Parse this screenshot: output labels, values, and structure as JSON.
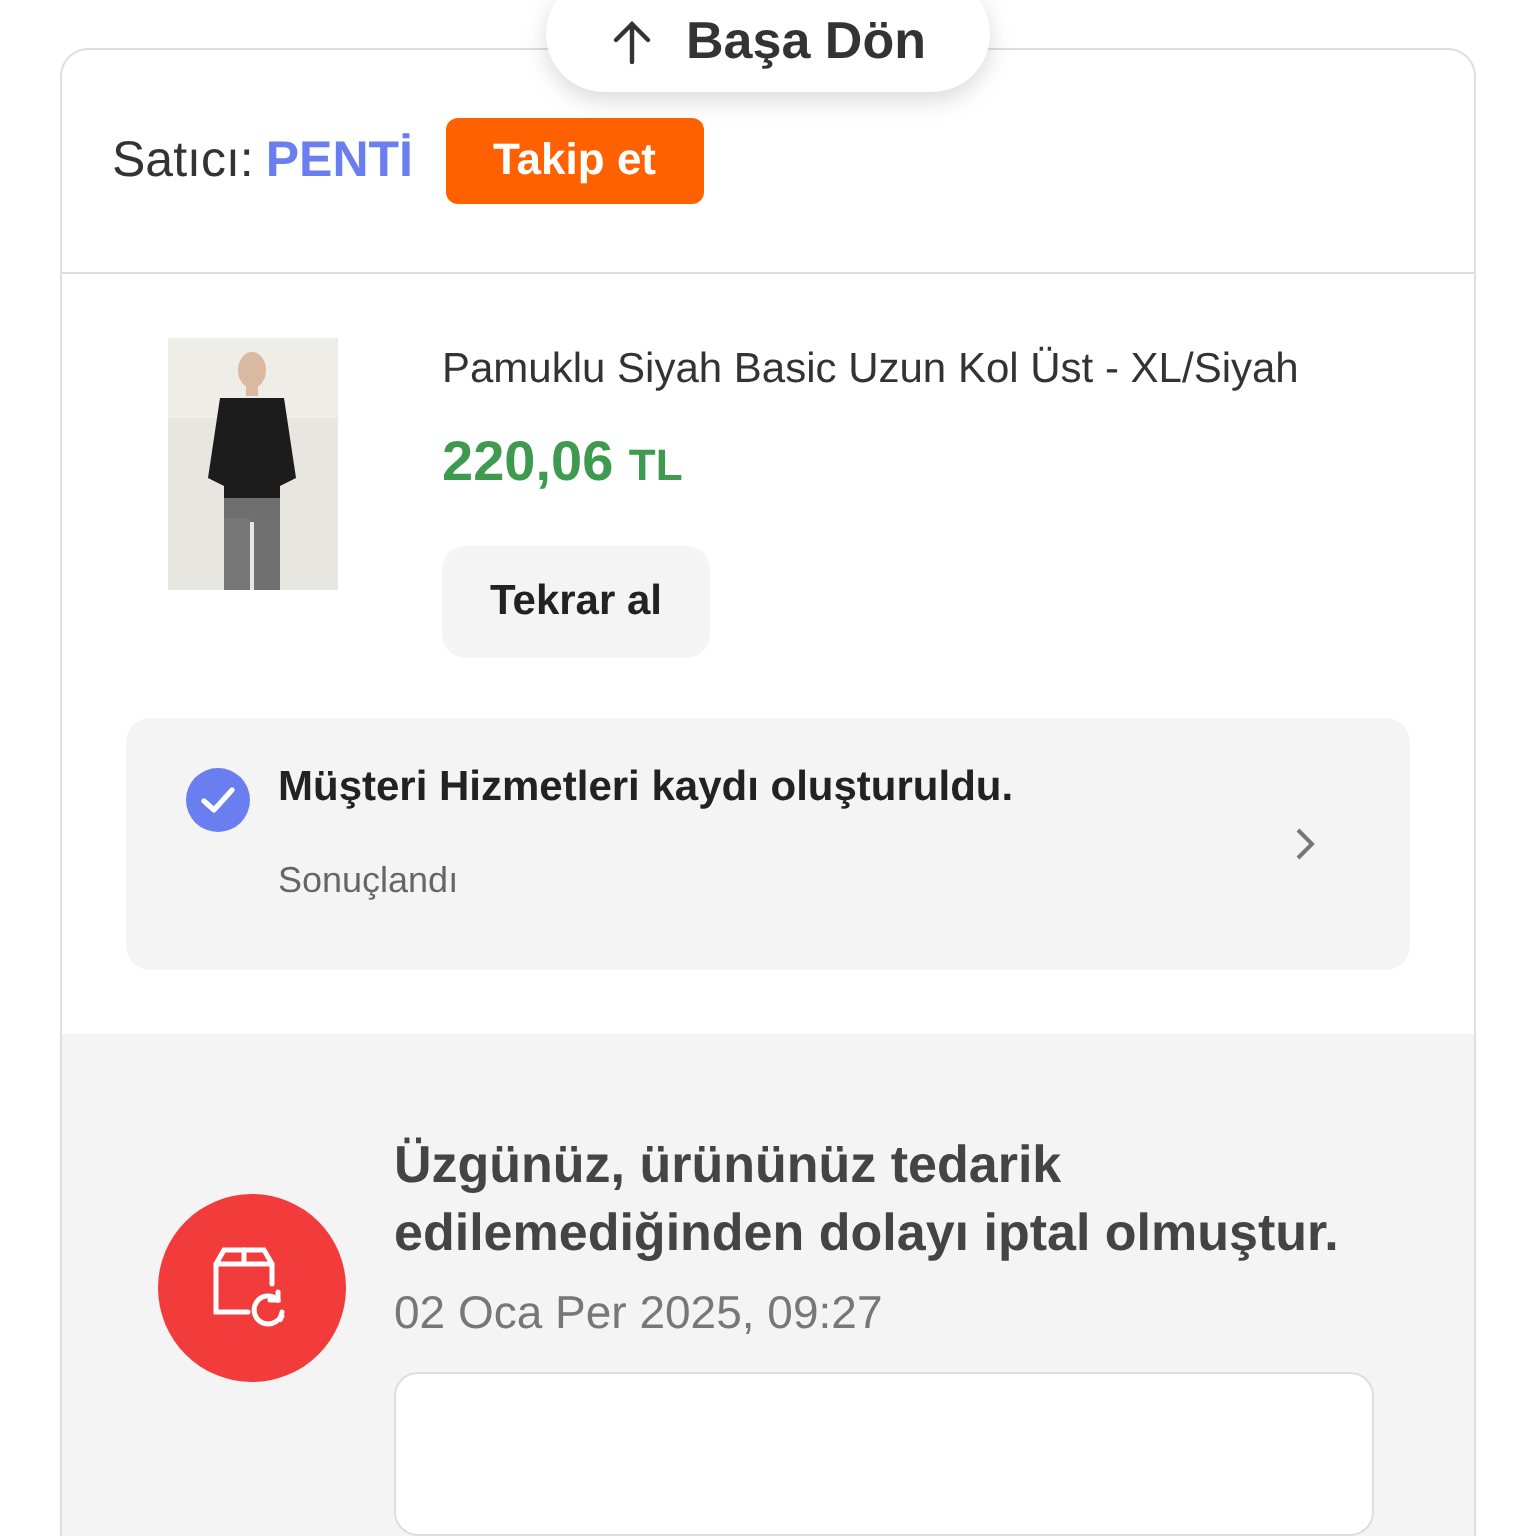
{
  "back_to_top": {
    "label": "Başa Dön"
  },
  "seller": {
    "label": "Satıcı:",
    "name": "PENTİ",
    "follow_button": "Takip et"
  },
  "product": {
    "title": "Pamuklu Siyah Basic Uzun Kol Üst - XL/Siyah",
    "price": "220,06",
    "currency": "TL",
    "rebuy_button": "Tekrar al"
  },
  "support_ticket": {
    "title": "Müşteri Hizmetleri kaydı oluşturuldu.",
    "status": "Sonuçlandı"
  },
  "cancellation": {
    "message": "Üzgünüz, ürününüz tedarik edilemediğinden dolayı iptal olmuştur.",
    "date": "02 Oca Per 2025, 09:27"
  }
}
